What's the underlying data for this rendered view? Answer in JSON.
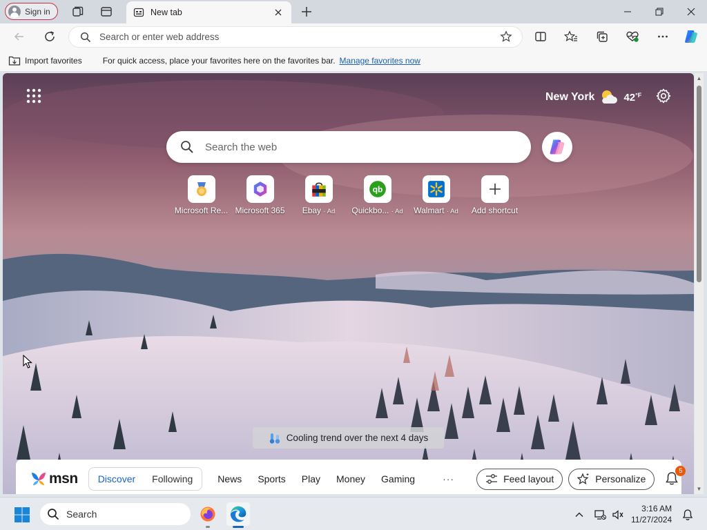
{
  "browser": {
    "sign_in_label": "Sign in",
    "tab_title": "New tab",
    "address_placeholder": "Search or enter web address"
  },
  "favorites_bar": {
    "import_label": "Import favorites",
    "message": "For quick access, place your favorites here on the favorites bar.",
    "manage_link": "Manage favorites now"
  },
  "newtab": {
    "weather": {
      "city": "New York",
      "temp": "42",
      "unit": "°F"
    },
    "search_placeholder": "Search the web",
    "shortcuts": [
      {
        "label": "Microsoft Re...",
        "ad": ""
      },
      {
        "label": "Microsoft 365",
        "ad": ""
      },
      {
        "label": "Ebay",
        "ad": "· Ad"
      },
      {
        "label": "Quickbo...",
        "ad": "· Ad"
      },
      {
        "label": "Walmart",
        "ad": "· Ad"
      },
      {
        "label": "Add shortcut",
        "ad": ""
      }
    ],
    "weather_trend": "Cooling trend over the next 4 days"
  },
  "msn_bar": {
    "logo_text": "msn",
    "tabs": [
      "Discover",
      "Following"
    ],
    "active_tab": "Discover",
    "nav": [
      "News",
      "Sports",
      "Play",
      "Money",
      "Gaming"
    ],
    "more": "···",
    "feed_layout_label": "Feed layout",
    "personalize_label": "Personalize",
    "notification_count": "5"
  },
  "taskbar": {
    "search_label": "Search",
    "time": "3:16 AM",
    "date": "11/27/2024"
  },
  "colors": {
    "accent": "#1664c0",
    "signin_border": "#c4314b",
    "badge": "#e8590c"
  },
  "icons": [
    "profile-icon",
    "workspaces-icon",
    "tab-actions-icon",
    "newtab-page-icon",
    "close-icon",
    "plus-icon",
    "minimize-icon",
    "restore-icon",
    "back-icon",
    "refresh-icon",
    "search-icon",
    "star-icon",
    "split-screen-icon",
    "favorites-icon",
    "collections-icon",
    "browser-essentials-icon",
    "more-icon",
    "copilot-icon",
    "apps-grid-icon",
    "weather-icon",
    "gear-icon",
    "thermometer-icon",
    "bell-icon",
    "windows-start-icon",
    "firefox-icon",
    "edge-icon",
    "chevron-up-icon",
    "network-icon",
    "volume-icon"
  ]
}
